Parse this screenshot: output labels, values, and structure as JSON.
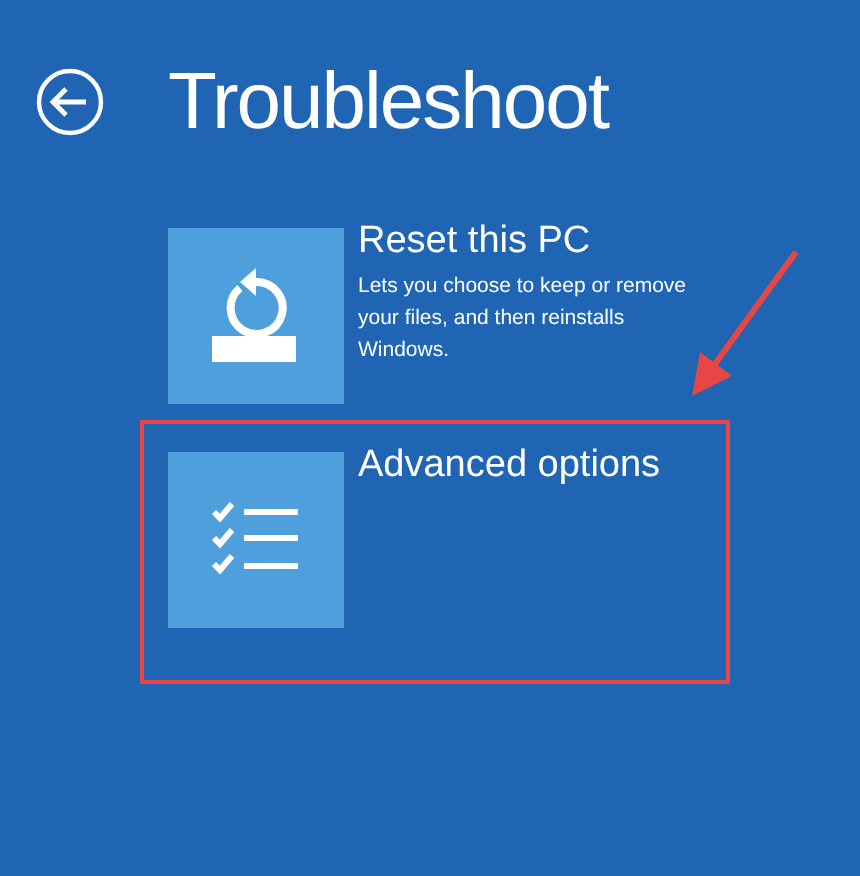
{
  "title": "Troubleshoot",
  "options": [
    {
      "kind": "reset",
      "label": "Reset this PC",
      "description": "Lets you choose to keep or remove your files, and then reinstalls Windows.",
      "highlighted": false
    },
    {
      "kind": "advanced",
      "label": "Advanced options",
      "highlighted": true
    }
  ]
}
